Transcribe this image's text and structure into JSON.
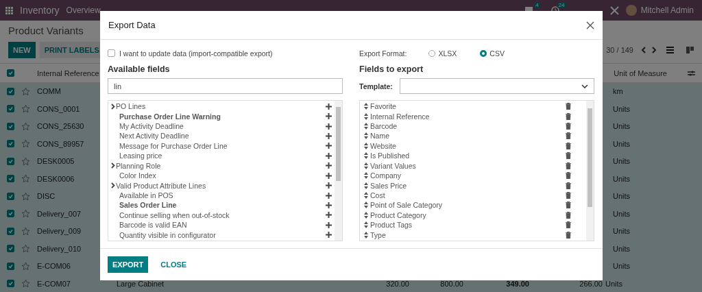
{
  "navbar": {
    "app": "Inventory",
    "menu": [
      "Overview"
    ],
    "messages_count": "4",
    "activities_count": "24",
    "user": "Mitchell Admin"
  },
  "control_panel": {
    "title": "Product Variants",
    "buttons": [
      "NEW",
      "PRINT LABELS"
    ],
    "pager": "30 / 149"
  },
  "table": {
    "columns": [
      "Internal Reference",
      "Unit of Measure"
    ],
    "all_selected": true,
    "rows": [
      {
        "reference": "COMM",
        "unit": "km",
        "selected": true
      },
      {
        "reference": "CONS_0001",
        "unit": "Units",
        "selected": true
      },
      {
        "reference": "CONS_25630",
        "unit": "Units",
        "selected": true
      },
      {
        "reference": "CONS_89957",
        "unit": "Units",
        "selected": true
      },
      {
        "reference": "DESK0005",
        "unit": "Units",
        "selected": true
      },
      {
        "reference": "DESK0006",
        "unit": "Units",
        "selected": true
      },
      {
        "reference": "DISC",
        "unit": "Units",
        "selected": true
      },
      {
        "reference": "Delivery_007",
        "unit": "Units",
        "selected": true
      },
      {
        "reference": "Delivery_009",
        "unit": "Units",
        "selected": true
      },
      {
        "reference": "Delivery_010",
        "unit": "Units",
        "selected": true
      },
      {
        "reference": "E-COM06",
        "unit": "Units",
        "selected": true
      },
      {
        "reference": "E-COM07",
        "name": "Large Cabinet",
        "values": [
          "320.00",
          "800.00",
          "349.00",
          "266.00"
        ],
        "unit": "Units",
        "selected": true
      }
    ]
  },
  "dialog": {
    "title": "Export Data",
    "import_compatible": {
      "label": "I want to update data (import-compatible export)",
      "checked": false
    },
    "available_fields": {
      "heading": "Available fields",
      "search": "lin",
      "items": [
        {
          "label": "PO Lines",
          "kind": "group",
          "bold": false
        },
        {
          "label": "Purchase Order Line Warning",
          "kind": "field",
          "bold": true
        },
        {
          "label": "My Activity Deadline",
          "kind": "field",
          "bold": false
        },
        {
          "label": "Next Activity Deadline",
          "kind": "field",
          "bold": false
        },
        {
          "label": "Message for Purchase Order Line",
          "kind": "field",
          "bold": false
        },
        {
          "label": "Leasing price",
          "kind": "field",
          "bold": false
        },
        {
          "label": "Planning Role",
          "kind": "group",
          "bold": false
        },
        {
          "label": "Color Index",
          "kind": "field",
          "bold": false
        },
        {
          "label": "Valid Product Attribute Lines",
          "kind": "group",
          "bold": false
        },
        {
          "label": "Available in POS",
          "kind": "field",
          "bold": false
        },
        {
          "label": "Sales Order Line",
          "kind": "field",
          "bold": true
        },
        {
          "label": "Continue selling when out-of-stock",
          "kind": "field",
          "bold": false
        },
        {
          "label": "Barcode is valid EAN",
          "kind": "field",
          "bold": false
        },
        {
          "label": "Quantity visible in configurator",
          "kind": "field",
          "bold": false
        }
      ]
    },
    "export_format": {
      "label": "Export Format:",
      "options": [
        {
          "label": "XLSX",
          "selected": false
        },
        {
          "label": "CSV",
          "selected": true
        }
      ]
    },
    "fields_to_export": {
      "heading": "Fields to export",
      "template_label": "Template:",
      "items": [
        "Favorite",
        "Internal Reference",
        "Barcode",
        "Name",
        "Website",
        "Is Published",
        "Variant Values",
        "Company",
        "Sales Price",
        "Cost",
        "Point of Sale Category",
        "Product Category",
        "Product Tags",
        "Type"
      ]
    },
    "buttons": [
      "EXPORT",
      "CLOSE"
    ]
  }
}
